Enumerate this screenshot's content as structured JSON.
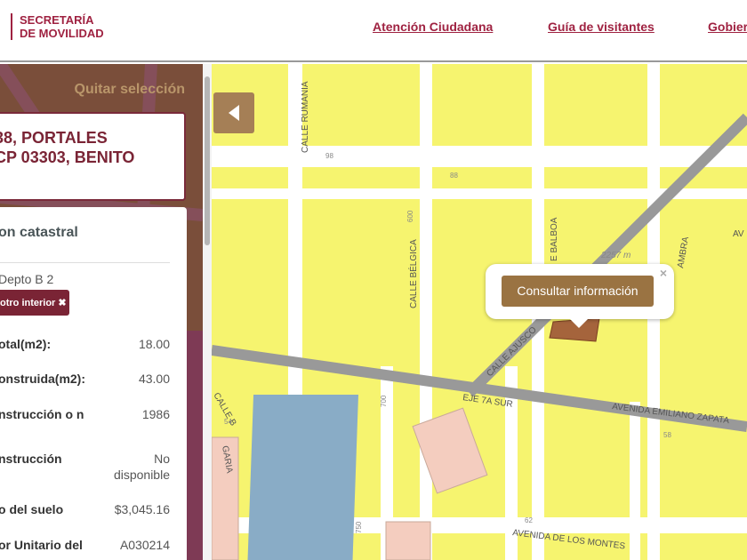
{
  "header": {
    "logo_line1": "SECRETARÍA",
    "logo_line2": "DE MOVILIDAD",
    "nav": [
      "Atención Ciudadana",
      "Guía de visitantes",
      "Gobierno"
    ]
  },
  "panel": {
    "clear_selection": "Quitar selección",
    "address_line1": "38, PORTALES",
    "address_line2": "CP 03303, BENITO",
    "info_title": "on catastral",
    "unit": "Depto B 2",
    "other_interior_button": "otro interior ✖",
    "rows": [
      {
        "label": "otal(m2):",
        "value": "18.00"
      },
      {
        "label": "onstruida(m2):",
        "value": "43.00"
      },
      {
        "label": "nstrucción o n",
        "value": "1986"
      },
      {
        "label": "nstrucción",
        "value": "No disponible"
      },
      {
        "label": "o del suelo",
        "value": "$3,045.16"
      },
      {
        "label": "or Unitario del",
        "value": "A030214"
      }
    ]
  },
  "map": {
    "popup_button": "Consultar información",
    "popup_close": "×",
    "streets": {
      "rumania": "CALLE RUMANIA",
      "belgica": "CALLE BÉLGICA",
      "ajusco": "CALLE AJUSCO",
      "eje": "EJE 7A SUR",
      "zapata": "AVENIDA EMILIANO ZAPATA",
      "montes": "AVENIDA DE LOS MONTES",
      "balboa": "E BALBOA",
      "ambra": "AMBRA",
      "garia": "GARIA",
      "calle_b": "CALLE B",
      "av": "AV"
    },
    "numbers": {
      "n98": "98",
      "n88": "88",
      "n600": "600",
      "n700": "700",
      "n750": "750",
      "n2257": "2257 m",
      "n58": "58",
      "n54": "54",
      "n62": "62"
    }
  }
}
